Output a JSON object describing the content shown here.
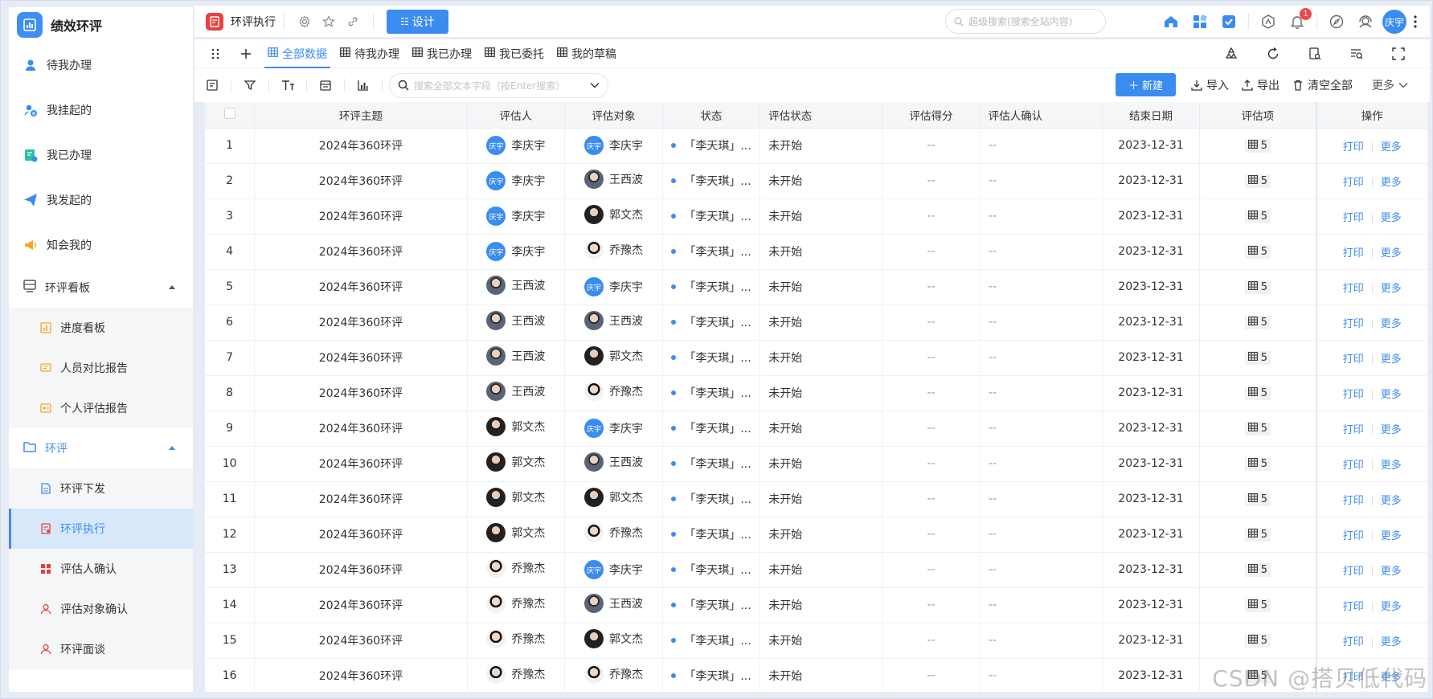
{
  "app": {
    "name": "绩效环评"
  },
  "sidebar": {
    "items": [
      {
        "label": "待我办理",
        "icon": "user-icon",
        "color": "#3b8cf0"
      },
      {
        "label": "我挂起的",
        "icon": "user-pause-icon",
        "color": "#3b8cf0"
      },
      {
        "label": "我已办理",
        "icon": "done-list-icon",
        "color": "#2dbfa3"
      },
      {
        "label": "我发起的",
        "icon": "send-icon",
        "color": "#3b8cf0"
      },
      {
        "label": "知会我的",
        "icon": "megaphone-icon",
        "color": "#f5a623"
      }
    ],
    "board_group": {
      "label": "环评看板"
    },
    "board_items": [
      {
        "label": "进度看板"
      },
      {
        "label": "人员对比报告"
      },
      {
        "label": "个人评估报告"
      }
    ],
    "review_group": {
      "label": "环评"
    },
    "review_items": [
      {
        "label": "环评下发"
      },
      {
        "label": "环评执行"
      },
      {
        "label": "评估人确认"
      },
      {
        "label": "评估对象确认"
      },
      {
        "label": "环评面谈"
      }
    ]
  },
  "topbar": {
    "title": "环评执行",
    "design_label": "设计",
    "search_placeholder": "超级搜索(搜索全站内容)",
    "notification_count": "1",
    "user_initials": "庆宇"
  },
  "tabs": [
    {
      "label": "全部数据",
      "active": true
    },
    {
      "label": "待我办理"
    },
    {
      "label": "我已办理"
    },
    {
      "label": "我已委托"
    },
    {
      "label": "我的草稿"
    }
  ],
  "toolbar": {
    "search_placeholder": "搜索全部文本字段（按Enter搜索）",
    "new_label": "新建",
    "import_label": "导入",
    "export_label": "导出",
    "clear_label": "清空全部",
    "more_label": "更多"
  },
  "table": {
    "headers": [
      "环评主题",
      "评估人",
      "评估对象",
      "状态",
      "评估状态",
      "评估得分",
      "评估人确认",
      "结束日期",
      "评估项",
      "操作"
    ],
    "rows": [
      {
        "no": "1",
        "topic": "2024年360环评",
        "assessor": "李庆宇",
        "assessor_av": "qy",
        "target": "李庆宇",
        "target_av": "qy",
        "status": "「李天琪」...",
        "eval_status": "未开始",
        "score": "--",
        "confirm": "--",
        "end_date": "2023-12-31",
        "items": "5"
      },
      {
        "no": "2",
        "topic": "2024年360环评",
        "assessor": "李庆宇",
        "assessor_av": "qy",
        "target": "王西波",
        "target_av": "photo",
        "status": "「李天琪」...",
        "eval_status": "未开始",
        "score": "--",
        "confirm": "--",
        "end_date": "2023-12-31",
        "items": "5"
      },
      {
        "no": "3",
        "topic": "2024年360环评",
        "assessor": "李庆宇",
        "assessor_av": "qy",
        "target": "郭文杰",
        "target_av": "photo2",
        "status": "「李天琪」...",
        "eval_status": "未开始",
        "score": "--",
        "confirm": "--",
        "end_date": "2023-12-31",
        "items": "5"
      },
      {
        "no": "4",
        "topic": "2024年360环评",
        "assessor": "李庆宇",
        "assessor_av": "qy",
        "target": "乔豫杰",
        "target_av": "photo3",
        "status": "「李天琪」...",
        "eval_status": "未开始",
        "score": "--",
        "confirm": "--",
        "end_date": "2023-12-31",
        "items": "5"
      },
      {
        "no": "5",
        "topic": "2024年360环评",
        "assessor": "王西波",
        "assessor_av": "photo",
        "target": "李庆宇",
        "target_av": "qy",
        "status": "「李天琪」...",
        "eval_status": "未开始",
        "score": "--",
        "confirm": "--",
        "end_date": "2023-12-31",
        "items": "5"
      },
      {
        "no": "6",
        "topic": "2024年360环评",
        "assessor": "王西波",
        "assessor_av": "photo",
        "target": "王西波",
        "target_av": "photo",
        "status": "「李天琪」...",
        "eval_status": "未开始",
        "score": "--",
        "confirm": "--",
        "end_date": "2023-12-31",
        "items": "5"
      },
      {
        "no": "7",
        "topic": "2024年360环评",
        "assessor": "王西波",
        "assessor_av": "photo",
        "target": "郭文杰",
        "target_av": "photo2",
        "status": "「李天琪」...",
        "eval_status": "未开始",
        "score": "--",
        "confirm": "--",
        "end_date": "2023-12-31",
        "items": "5"
      },
      {
        "no": "8",
        "topic": "2024年360环评",
        "assessor": "王西波",
        "assessor_av": "photo",
        "target": "乔豫杰",
        "target_av": "photo3",
        "status": "「李天琪」...",
        "eval_status": "未开始",
        "score": "--",
        "confirm": "--",
        "end_date": "2023-12-31",
        "items": "5"
      },
      {
        "no": "9",
        "topic": "2024年360环评",
        "assessor": "郭文杰",
        "assessor_av": "photo2",
        "target": "李庆宇",
        "target_av": "qy",
        "status": "「李天琪」...",
        "eval_status": "未开始",
        "score": "--",
        "confirm": "--",
        "end_date": "2023-12-31",
        "items": "5"
      },
      {
        "no": "10",
        "topic": "2024年360环评",
        "assessor": "郭文杰",
        "assessor_av": "photo2",
        "target": "王西波",
        "target_av": "photo",
        "status": "「李天琪」...",
        "eval_status": "未开始",
        "score": "--",
        "confirm": "--",
        "end_date": "2023-12-31",
        "items": "5"
      },
      {
        "no": "11",
        "topic": "2024年360环评",
        "assessor": "郭文杰",
        "assessor_av": "photo2",
        "target": "郭文杰",
        "target_av": "photo2",
        "status": "「李天琪」...",
        "eval_status": "未开始",
        "score": "--",
        "confirm": "--",
        "end_date": "2023-12-31",
        "items": "5"
      },
      {
        "no": "12",
        "topic": "2024年360环评",
        "assessor": "郭文杰",
        "assessor_av": "photo2",
        "target": "乔豫杰",
        "target_av": "photo3",
        "status": "「李天琪」...",
        "eval_status": "未开始",
        "score": "--",
        "confirm": "--",
        "end_date": "2023-12-31",
        "items": "5"
      },
      {
        "no": "13",
        "topic": "2024年360环评",
        "assessor": "乔豫杰",
        "assessor_av": "photo3",
        "target": "李庆宇",
        "target_av": "qy",
        "status": "「李天琪」...",
        "eval_status": "未开始",
        "score": "--",
        "confirm": "--",
        "end_date": "2023-12-31",
        "items": "5"
      },
      {
        "no": "14",
        "topic": "2024年360环评",
        "assessor": "乔豫杰",
        "assessor_av": "photo3",
        "target": "王西波",
        "target_av": "photo",
        "status": "「李天琪」...",
        "eval_status": "未开始",
        "score": "--",
        "confirm": "--",
        "end_date": "2023-12-31",
        "items": "5"
      },
      {
        "no": "15",
        "topic": "2024年360环评",
        "assessor": "乔豫杰",
        "assessor_av": "photo3",
        "target": "郭文杰",
        "target_av": "photo2",
        "status": "「李天琪」...",
        "eval_status": "未开始",
        "score": "--",
        "confirm": "--",
        "end_date": "2023-12-31",
        "items": "5"
      },
      {
        "no": "16",
        "topic": "2024年360环评",
        "assessor": "乔豫杰",
        "assessor_av": "photo3",
        "target": "乔豫杰",
        "target_av": "photo3",
        "status": "「李天琪」...",
        "eval_status": "未开始",
        "score": "--",
        "confirm": "--",
        "end_date": "2023-12-31",
        "items": "5"
      }
    ],
    "op_print": "打印",
    "op_more": "更多",
    "avatar_short": "庆宇"
  },
  "watermark": "CSDN @搭贝低代码",
  "colors": {
    "accent": "#3b8cf0",
    "danger": "#f04646"
  }
}
